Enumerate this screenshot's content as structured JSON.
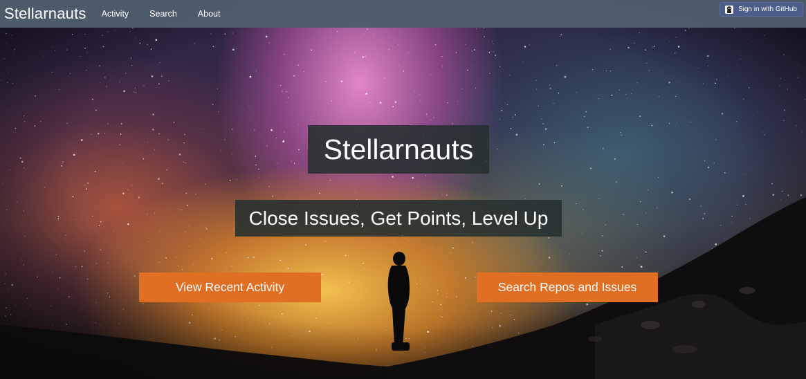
{
  "navbar": {
    "brand": "Stellarnauts",
    "links": [
      {
        "label": "Activity"
      },
      {
        "label": "Search"
      },
      {
        "label": "About"
      }
    ],
    "signin": {
      "label": "Sign in with GitHub",
      "icon": "octocat-icon"
    }
  },
  "hero": {
    "title": "Stellarnauts",
    "subtitle": "Close Issues, Get Points, Level Up",
    "buttons": [
      {
        "label": "View Recent Activity"
      },
      {
        "label": "Search Repos and Issues"
      }
    ]
  },
  "colors": {
    "navbar_bg": "#4e5d6c",
    "cta_bg": "#e06e23",
    "heading_box_bg": "#263030",
    "signin_bg": "#4a5c87"
  }
}
